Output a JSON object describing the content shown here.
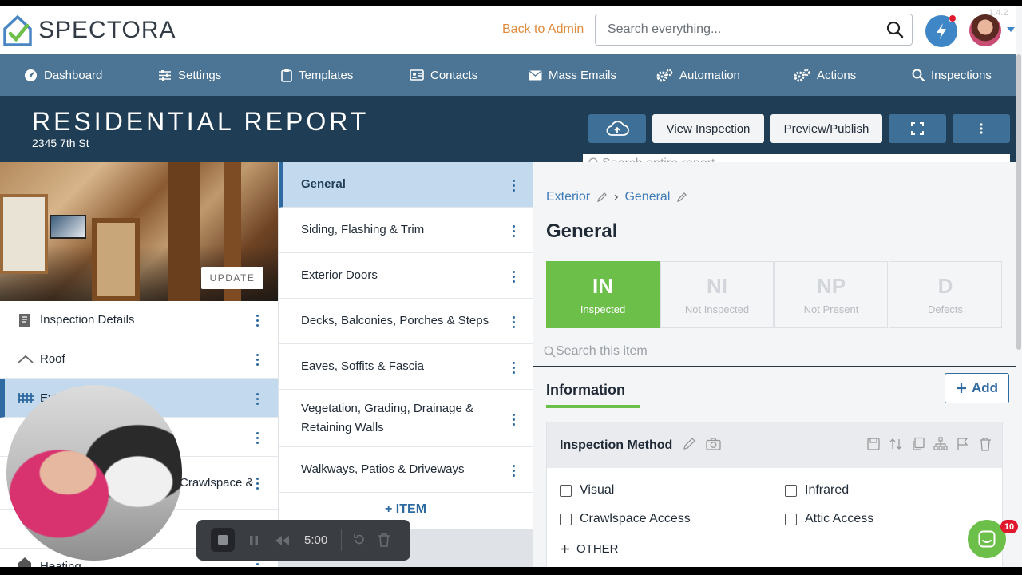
{
  "app": {
    "brand": "SPECTORA",
    "back_to_admin": "Back to Admin",
    "search_placeholder": "Search everything...",
    "version": "1.4.2"
  },
  "nav": {
    "items": [
      {
        "label": "Dashboard",
        "icon": "dashboard-icon"
      },
      {
        "label": "Settings",
        "icon": "sliders-icon"
      },
      {
        "label": "Templates",
        "icon": "clipboard-icon"
      },
      {
        "label": "Contacts",
        "icon": "contact-card-icon"
      },
      {
        "label": "Mass Emails",
        "icon": "envelope-icon"
      },
      {
        "label": "Automation",
        "icon": "gears-icon"
      },
      {
        "label": "Actions",
        "icon": "gears-icon"
      },
      {
        "label": "Inspections",
        "icon": "search-icon"
      }
    ]
  },
  "report": {
    "title": "RESIDENTIAL REPORT",
    "address": "2345 7th St",
    "view_inspection": "View Inspection",
    "preview_publish": "Preview/Publish",
    "search_placeholder": "Search entire report",
    "update_label": "UPDATE"
  },
  "sections": [
    {
      "label": "Inspection Details",
      "icon": "document-icon"
    },
    {
      "label": "Roof",
      "icon": "roof-icon"
    },
    {
      "label": "Exterior",
      "icon": "fence-icon",
      "active": true
    },
    {
      "label": "",
      "icon": ""
    },
    {
      "label": "Crawlspace &",
      "icon": ""
    },
    {
      "label": "",
      "icon": ""
    },
    {
      "label": "Heating",
      "icon": "house-icon"
    }
  ],
  "subsections": [
    {
      "label": "General",
      "active": true
    },
    {
      "label": "Siding, Flashing & Trim"
    },
    {
      "label": "Exterior Doors"
    },
    {
      "label": "Decks, Balconies, Porches & Steps"
    },
    {
      "label": "Eaves, Soffits & Fascia"
    },
    {
      "label": "Vegetation, Grading, Drainage & Retaining Walls"
    },
    {
      "label": "Walkways, Patios & Driveways"
    }
  ],
  "add_item_label": "ITEM",
  "detail": {
    "breadcrumb": [
      "Exterior",
      "General"
    ],
    "title": "General",
    "statuses": [
      {
        "code": "IN",
        "name": "Inspected",
        "active": true
      },
      {
        "code": "NI",
        "name": "Not Inspected"
      },
      {
        "code": "NP",
        "name": "Not Present"
      },
      {
        "code": "D",
        "name": "Defects"
      }
    ],
    "item_search_placeholder": "Search this item",
    "tab": "Information",
    "add_label": "Add",
    "card": {
      "title": "Inspection Method",
      "options": [
        "Visual",
        "Infrared",
        "Crawlspace Access",
        "Attic Access"
      ],
      "other_label": "OTHER"
    }
  },
  "recorder": {
    "time": "5:00"
  },
  "chat": {
    "badge": "10"
  },
  "colors": {
    "nav_bg": "#4c7595",
    "header_bg": "#1f3e56",
    "accent_blue": "#2f6aa0",
    "inspected_green": "#6cc04a",
    "admin_orange": "#e08a3c"
  }
}
